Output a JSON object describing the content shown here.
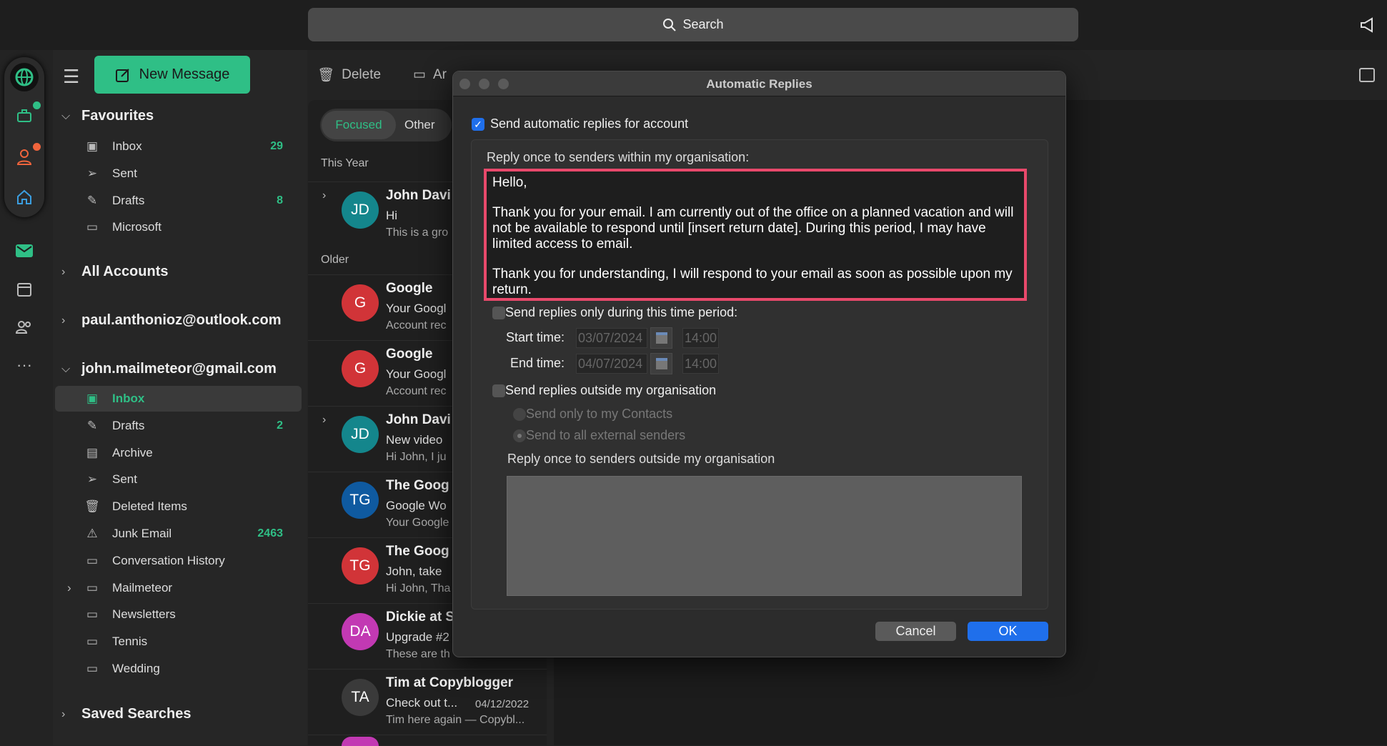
{
  "search": {
    "label": "Search",
    "icon": "search-icon"
  },
  "toolbar": {
    "delete": "Delete",
    "archive": "Ar"
  },
  "rail": {
    "accent_green": "#2fbf86",
    "badge_orange": "#f0643c"
  },
  "new_message": "New Message",
  "favourites": {
    "title": "Favourites",
    "items": [
      {
        "label": "Inbox",
        "count": "29",
        "icon": "inbox-icon"
      },
      {
        "label": "Sent",
        "count": "",
        "icon": "send-icon"
      },
      {
        "label": "Drafts",
        "count": "8",
        "icon": "drafts-icon"
      },
      {
        "label": "Microsoft",
        "count": "",
        "icon": "folder-icon"
      }
    ]
  },
  "all_accounts": "All Accounts",
  "account1": "paul.anthonioz@outlook.com",
  "account2": {
    "title": "john.mailmeteor@gmail.com",
    "items": [
      {
        "label": "Inbox",
        "count": ""
      },
      {
        "label": "Drafts",
        "count": "2"
      },
      {
        "label": "Archive",
        "count": ""
      },
      {
        "label": "Sent",
        "count": ""
      },
      {
        "label": "Deleted Items",
        "count": ""
      },
      {
        "label": "Junk Email",
        "count": "2463"
      },
      {
        "label": "Conversation History",
        "count": ""
      },
      {
        "label": "Mailmeteor",
        "count": ""
      },
      {
        "label": "Newsletters",
        "count": ""
      },
      {
        "label": "Tennis",
        "count": ""
      },
      {
        "label": "Wedding",
        "count": ""
      }
    ]
  },
  "saved_searches": "Saved Searches",
  "list": {
    "tabs": [
      "Focused",
      "Other"
    ],
    "group_this_year": "This Year",
    "group_older": "Older",
    "messages": [
      {
        "initials": "JD",
        "color": "#14868c",
        "sender": "John Davi",
        "subject": "Hi",
        "preview": "This is a gro",
        "date": "",
        "expand": true
      },
      {
        "initials": "G",
        "color": "#d13438",
        "sender": "Google",
        "subject": "Your Googl",
        "preview": "Account rec",
        "date": "",
        "expand": false
      },
      {
        "initials": "G",
        "color": "#d13438",
        "sender": "Google",
        "subject": "Your Googl",
        "preview": "Account rec",
        "date": "",
        "expand": false
      },
      {
        "initials": "JD",
        "color": "#14868c",
        "sender": "John Davi",
        "subject": "New video",
        "preview": "Hi John, I ju",
        "date": "",
        "expand": true
      },
      {
        "initials": "TG",
        "color": "#0f5aa0",
        "sender": "The Goog",
        "subject": "Google Wo",
        "preview": "Your Google",
        "date": "",
        "expand": false
      },
      {
        "initials": "TG",
        "color": "#d13438",
        "sender": "The Goog",
        "subject": "John, take",
        "preview": "Hi John, Tha",
        "date": "",
        "expand": false
      },
      {
        "initials": "DA",
        "color": "#c239b3",
        "sender": "Dickie at S",
        "subject": "Upgrade #2",
        "preview": "These are th",
        "date": "",
        "expand": false
      },
      {
        "initials": "TA",
        "color": "#3a3a3a",
        "sender": "Tim at Copyblogger",
        "subject": "Check out t...",
        "preview": "Tim here again — Copybl...",
        "date": "04/12/2022",
        "expand": false
      }
    ]
  },
  "dialog": {
    "title": "Automatic Replies",
    "enable_label": "Send automatic replies for account",
    "enabled": true,
    "inside_label": "Reply once to senders within my organisation:",
    "message": [
      "Hello,",
      "Thank you for your email. I am currently out of the office on a planned vacation and will not be available to respond until [insert return date]. During this period, I may have limited access to email.",
      "Thank you for understanding, I will respond to your email as soon as possible upon my return."
    ],
    "time_period_label": "Send replies only during this time period:",
    "start_label": "Start time:",
    "start_date": "03/07/2024",
    "start_time": "14:00",
    "end_label": "End time:",
    "end_date": "04/07/2024",
    "end_time": "14:00",
    "outside_label": "Send replies outside my organisation",
    "radio_contacts": "Send only to my Contacts",
    "radio_all": "Send to all external senders",
    "outside_msg_label": "Reply once to senders outside my organisation",
    "cancel": "Cancel",
    "ok": "OK",
    "highlight_color": "#e8496b"
  }
}
